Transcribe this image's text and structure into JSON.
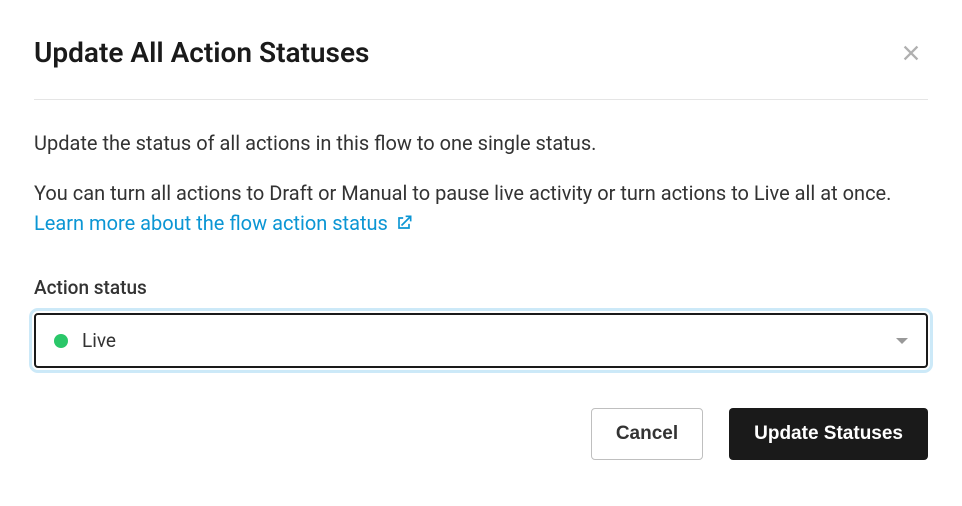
{
  "modal": {
    "title": "Update All Action Statuses",
    "description_1": "Update the status of all actions in this flow to one single status.",
    "description_2_pre": "You can turn all actions to Draft or Manual to pause live activity or turn actions to Live all at once. ",
    "learn_more_label": "Learn more about the flow action status"
  },
  "field": {
    "label": "Action status",
    "selected_value": "Live",
    "status_color": "#2ac769"
  },
  "buttons": {
    "cancel": "Cancel",
    "submit": "Update Statuses"
  }
}
